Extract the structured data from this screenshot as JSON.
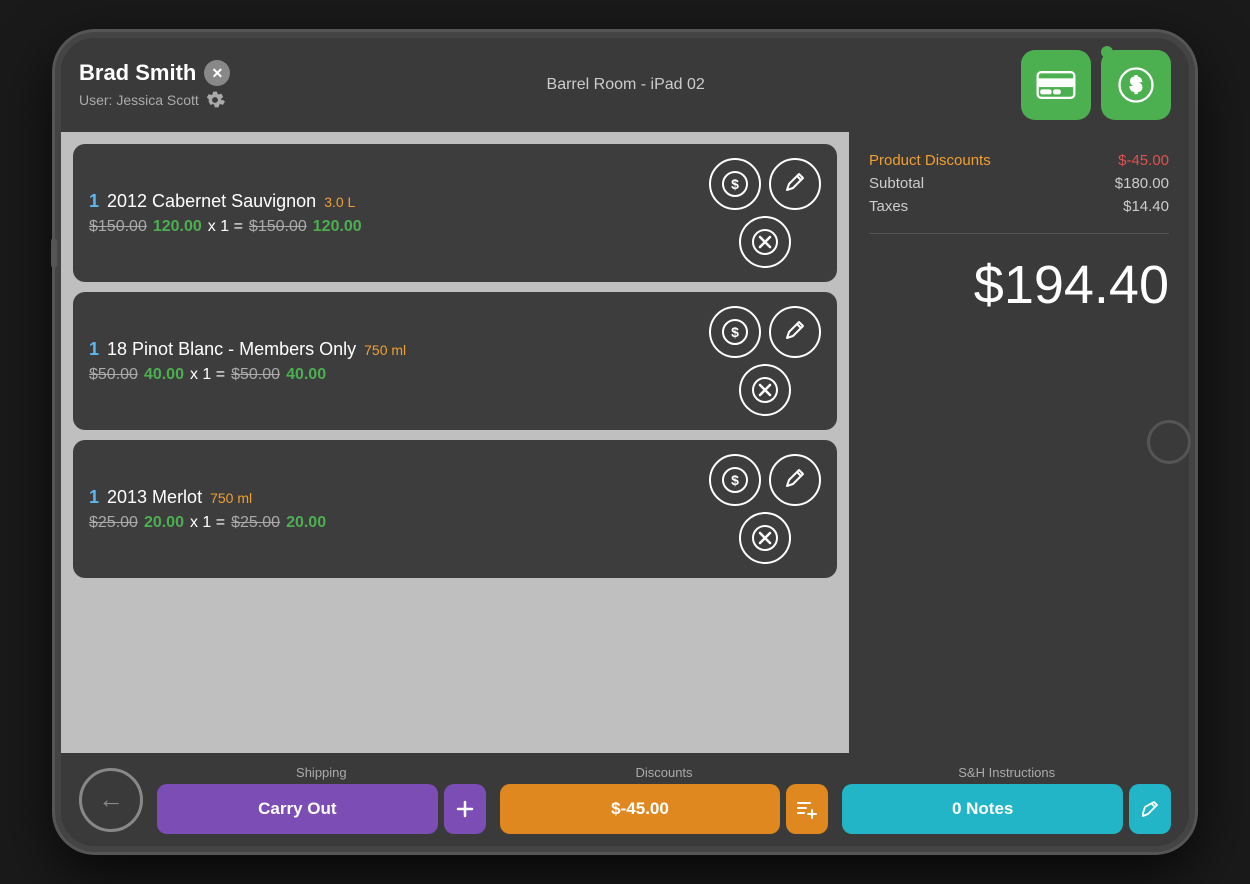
{
  "header": {
    "customer_name": "Brad Smith",
    "user_label": "User: Jessica Scott",
    "device_label": "Barrel Room - iPad 02"
  },
  "items": [
    {
      "qty": "1",
      "name": "2012 Cabernet Sauvignon",
      "size": "3.0 L",
      "orig_price": "$150.00",
      "sale_price": "120.00",
      "multiplier": "x 1 =",
      "line_orig": "$150.00",
      "line_sale": "120.00"
    },
    {
      "qty": "1",
      "name": "18 Pinot Blanc - Members Only",
      "size": "750 ml",
      "orig_price": "$50.00",
      "sale_price": "40.00",
      "multiplier": "x 1 =",
      "line_orig": "$50.00",
      "line_sale": "40.00"
    },
    {
      "qty": "1",
      "name": "2013 Merlot",
      "size": "750 ml",
      "orig_price": "$25.00",
      "sale_price": "20.00",
      "multiplier": "x 1 =",
      "line_orig": "$25.00",
      "line_sale": "20.00"
    }
  ],
  "summary": {
    "product_discounts_label": "Product Discounts",
    "product_discounts_value": "$-45.00",
    "subtotal_label": "Subtotal",
    "subtotal_value": "$180.00",
    "taxes_label": "Taxes",
    "taxes_value": "$14.40",
    "total": "$194.40"
  },
  "footer": {
    "shipping_label": "Shipping",
    "shipping_btn": "Carry Out",
    "discounts_label": "Discounts",
    "discounts_btn": "$-45.00",
    "sh_label": "S&H Instructions",
    "sh_btn": "0 Notes"
  }
}
